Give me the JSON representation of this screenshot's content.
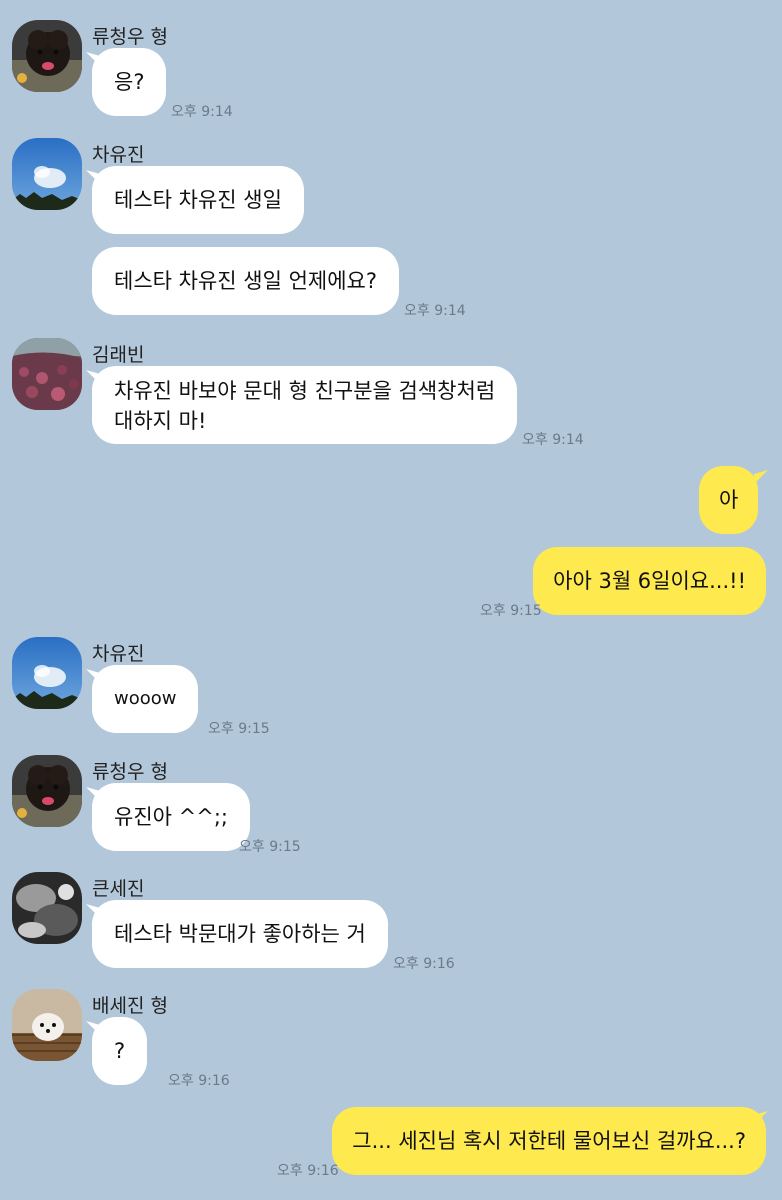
{
  "messages": [
    {
      "sender": "류청우 형",
      "text": "응?",
      "time": "오후 9:14"
    },
    {
      "sender": "차유진",
      "text": "테스타 차유진 생일"
    },
    {
      "text": "테스타 차유진 생일 언제에요?",
      "time": "오후 9:14"
    },
    {
      "sender": "김래빈",
      "text": "차유진 바보야 문대 형 친구분을 검색창처럼\n대하지 마!",
      "time": "오후 9:14"
    },
    {
      "text": "아"
    },
    {
      "text": "아아 3월 6일이요...!!",
      "time": "오후 9:15"
    },
    {
      "sender": "차유진",
      "text": "wooow",
      "time": "오후 9:15"
    },
    {
      "sender": "류청우 형",
      "text": "유진아 ^^;;",
      "time": "오후 9:15"
    },
    {
      "sender": "큰세진",
      "text": "테스타 박문대가 좋아하는 거",
      "time": "오후 9:16"
    },
    {
      "sender": "배세진 형",
      "text": "?",
      "time": "오후 9:16"
    },
    {
      "text": "그... 세진님 혹시 저한테 물어보신 걸까요...?",
      "time": "오후 9:16"
    }
  ],
  "colors": {
    "background": "#b2c7da",
    "incoming_bubble": "#ffffff",
    "outgoing_bubble": "#fee94e"
  }
}
